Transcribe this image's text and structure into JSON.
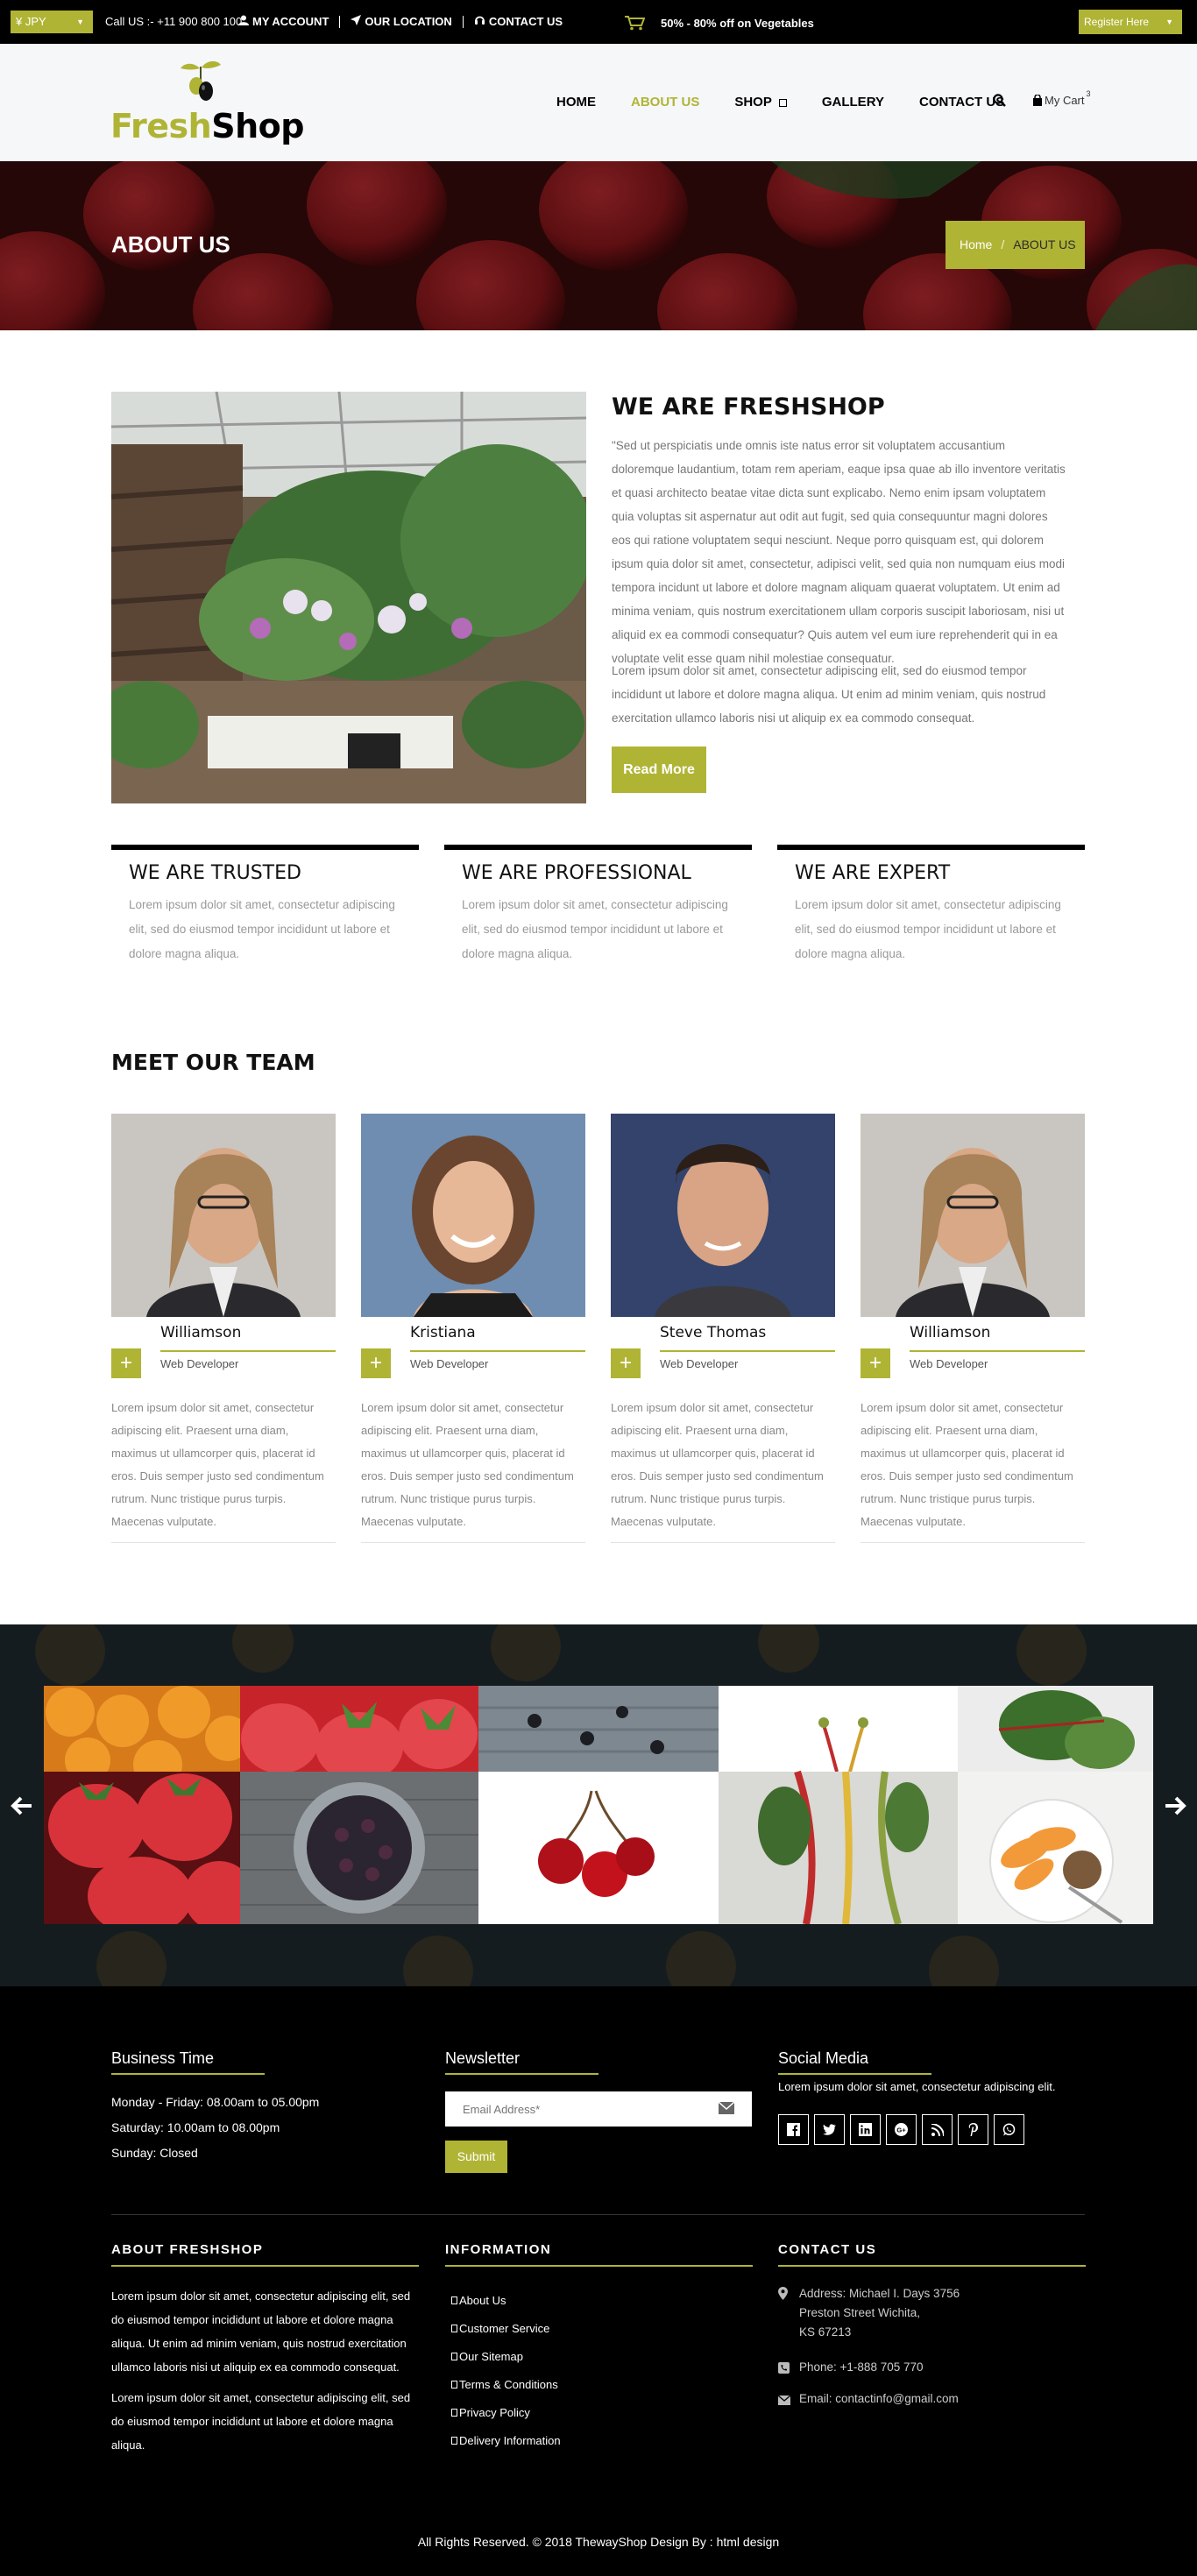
{
  "colors": {
    "accent": "#b0b435",
    "dark": "#000000",
    "footer": "#000000"
  },
  "topbar": {
    "currency": "¥ JPY",
    "call": "Call US :- +11 900 800 100",
    "links": [
      {
        "label": "MY ACCOUNT",
        "icon": "user-icon"
      },
      {
        "label": "OUR LOCATION",
        "icon": "location-arrow-icon"
      },
      {
        "label": "CONTACT US",
        "icon": "headset-icon"
      }
    ],
    "promo": "50% - 80% off on Vegetables",
    "register": "Register Here"
  },
  "header": {
    "logo_fresh": "Fresh",
    "logo_shop": "Shop",
    "nav": [
      "HOME",
      "ABOUT US",
      "SHOP",
      "GALLERY",
      "CONTACT US"
    ],
    "active_nav": "ABOUT US",
    "cart_label": "My Cart",
    "cart_count": "3"
  },
  "banner": {
    "title": "ABOUT US",
    "crumb_home": "Home",
    "crumb_sep": "/",
    "crumb_current": "ABOUT US"
  },
  "about": {
    "title": "WE ARE FRESHSHOP",
    "para1": "\"Sed ut perspiciatis unde omnis iste natus error sit voluptatem accusantium doloremque laudantium, totam rem aperiam, eaque ipsa quae ab illo inventore veritatis et quasi architecto beatae vitae dicta sunt explicabo. Nemo enim ipsam voluptatem quia voluptas sit aspernatur aut odit aut fugit, sed quia consequuntur magni dolores eos qui ratione voluptatem sequi nesciunt. Neque porro quisquam est, qui dolorem ipsum quia dolor sit amet, consectetur, adipisci velit, sed quia non numquam eius modi tempora incidunt ut labore et dolore magnam aliquam quaerat voluptatem. Ut enim ad minima veniam, quis nostrum exercitationem ullam corporis suscipit laboriosam, nisi ut aliquid ex ea commodi consequatur? Quis autem vel eum iure reprehenderit qui in ea voluptate velit esse quam nihil molestiae consequatur.",
    "para2": "Lorem ipsum dolor sit amet, consectetur adipiscing elit, sed do eiusmod tempor incididunt ut labore et dolore magna aliqua. Ut enim ad minim veniam, quis nostrud exercitation ullamco laboris nisi ut aliquip ex ea commodo consequat.",
    "button": "Read More"
  },
  "features": [
    {
      "title": "WE ARE TRUSTED",
      "text": "Lorem ipsum dolor sit amet, consectetur adipiscing elit, sed do eiusmod tempor incididunt ut labore et dolore magna aliqua."
    },
    {
      "title": "WE ARE PROFESSIONAL",
      "text": "Lorem ipsum dolor sit amet, consectetur adipiscing elit, sed do eiusmod tempor incididunt ut labore et dolore magna aliqua."
    },
    {
      "title": "WE ARE EXPERT",
      "text": "Lorem ipsum dolor sit amet, consectetur adipiscing elit, sed do eiusmod tempor incididunt ut labore et dolore magna aliqua."
    }
  ],
  "team": {
    "title": "MEET OUR TEAM",
    "members": [
      {
        "name": "Williamson",
        "role": "Web Developer",
        "bio": "Lorem ipsum dolor sit amet, consectetur adipiscing elit. Praesent urna diam, maximus ut ullamcorper quis, placerat id eros. Duis semper justo sed condimentum rutrum. Nunc tristique purus turpis. Maecenas vulputate."
      },
      {
        "name": "Kristiana",
        "role": "Web Developer",
        "bio": "Lorem ipsum dolor sit amet, consectetur adipiscing elit. Praesent urna diam, maximus ut ullamcorper quis, placerat id eros. Duis semper justo sed condimentum rutrum. Nunc tristique purus turpis. Maecenas vulputate."
      },
      {
        "name": "Steve Thomas",
        "role": "Web Developer",
        "bio": "Lorem ipsum dolor sit amet, consectetur adipiscing elit. Praesent urna diam, maximus ut ullamcorper quis, placerat id eros. Duis semper justo sed condimentum rutrum. Nunc tristique purus turpis. Maecenas vulputate."
      },
      {
        "name": "Williamson",
        "role": "Web Developer",
        "bio": "Lorem ipsum dolor sit amet, consectetur adipiscing elit. Praesent urna diam, maximus ut ullamcorper quis, placerat id eros. Duis semper justo sed condimentum rutrum. Nunc tristique purus turpis. Maecenas vulputate."
      }
    ]
  },
  "footer": {
    "business": {
      "title": "Business Time",
      "lines": [
        "Monday - Friday: 08.00am to 05.00pm",
        "Saturday: 10.00am to 08.00pm",
        "Sunday: Closed"
      ]
    },
    "newsletter": {
      "title": "Newsletter",
      "placeholder": "Email Address*",
      "button": "Submit"
    },
    "social": {
      "title": "Social Media",
      "text": "Lorem ipsum dolor sit amet, consectetur adipiscing elit.",
      "icons": [
        "facebook-icon",
        "twitter-icon",
        "linkedin-icon",
        "google-plus-icon",
        "rss-icon",
        "pinterest-icon",
        "whatsapp-icon"
      ]
    },
    "about": {
      "title": "ABOUT FRESHSHOP",
      "p1": "Lorem ipsum dolor sit amet, consectetur adipiscing elit, sed do eiusmod tempor incididunt ut labore et dolore magna aliqua. Ut enim ad minim veniam, quis nostrud exercitation ullamco laboris nisi ut aliquip ex ea commodo consequat.",
      "p2": "Lorem ipsum dolor sit amet, consectetur adipiscing elit, sed do eiusmod tempor incididunt ut labore et dolore magna aliqua."
    },
    "information": {
      "title": "INFORMATION",
      "items": [
        "About Us",
        "Customer Service",
        "Our Sitemap",
        "Terms & Conditions",
        "Privacy Policy",
        "Delivery Information"
      ]
    },
    "contact": {
      "title": "CONTACT US",
      "address_1": "Address: Michael I. Days 3756",
      "address_2": "Preston Street Wichita,",
      "address_3": "KS 67213",
      "phone": "Phone: +1-888 705 770",
      "email": "Email: contactinfo@gmail.com"
    },
    "copyright": "All Rights Reserved. © 2018 ThewayShop Design By : html design"
  }
}
